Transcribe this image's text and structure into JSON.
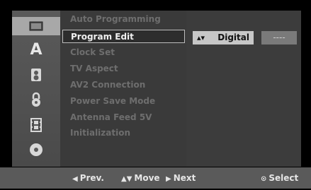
{
  "icons": [
    {
      "name": "film-reel-icon",
      "glyph": ""
    },
    {
      "name": "language-a-icon",
      "glyph": "A"
    },
    {
      "name": "speaker-audio-icon",
      "glyph": ""
    },
    {
      "name": "lock-icon",
      "glyph": ""
    },
    {
      "name": "film-strip-icon",
      "glyph": ""
    },
    {
      "name": "disc-icon",
      "glyph": ""
    }
  ],
  "menu": {
    "items": [
      {
        "label": "Auto Programming"
      },
      {
        "label": "Program Edit"
      },
      {
        "label": "Clock Set"
      },
      {
        "label": "TV Aspect"
      },
      {
        "label": "AV2 Connection"
      },
      {
        "label": "Power Save Mode"
      },
      {
        "label": "Antenna Feed 5V"
      },
      {
        "label": "Initialization"
      }
    ],
    "selected_index": 1
  },
  "option": {
    "arrow_glyph": "▴▾",
    "value": "Digital",
    "extra": "----"
  },
  "bottom": {
    "prev_glyph": "◀",
    "prev_label": "Prev.",
    "move_glyph": "▲▼",
    "move_label": "Move",
    "next_glyph": "▶",
    "next_label": "Next",
    "select_glyph": "⊙",
    "select_label": "Select"
  }
}
